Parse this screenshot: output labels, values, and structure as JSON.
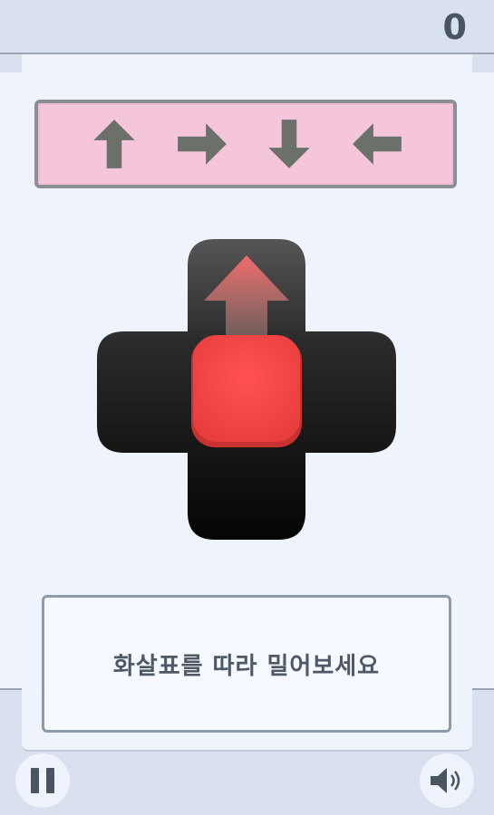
{
  "hud": {
    "counter": "0"
  },
  "sequence": {
    "arrows": [
      {
        "direction": "up",
        "icon": "arrow-up-icon"
      },
      {
        "direction": "right",
        "icon": "arrow-right-icon"
      },
      {
        "direction": "down",
        "icon": "arrow-down-icon"
      },
      {
        "direction": "left",
        "icon": "arrow-left-icon"
      }
    ],
    "background_color": "#f5c6da",
    "arrow_color": "#6b706b"
  },
  "dpad": {
    "indicated_direction": "up",
    "center_color": "#fa4949",
    "body_color": "#1f1f1f"
  },
  "message": {
    "text": "화살표를 따라 밀어보세요"
  },
  "controls": {
    "pause_icon": "pause-icon",
    "sound_icon": "speaker-icon"
  }
}
